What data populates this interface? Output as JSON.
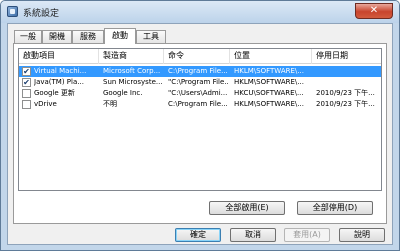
{
  "window": {
    "title": "系統設定",
    "close_label": "✕"
  },
  "tabs": [
    {
      "label": "一般",
      "active": false
    },
    {
      "label": "開機",
      "active": false
    },
    {
      "label": "服務",
      "active": false
    },
    {
      "label": "啟動",
      "active": true
    },
    {
      "label": "工具",
      "active": false
    }
  ],
  "startup_list": {
    "columns": [
      "啟動項目",
      "製造商",
      "命令",
      "位置",
      "停用日期"
    ],
    "rows": [
      {
        "checked": true,
        "selected": true,
        "cells": [
          "Virtual Machi...",
          "Microsoft Corp...",
          "C:\\Program File...",
          "HKLM\\SOFTWARE\\...",
          ""
        ]
      },
      {
        "checked": true,
        "selected": false,
        "cells": [
          "Java(TM) Pla...",
          "Sun Microsyste...",
          "\"C:\\Program File...",
          "HKLM\\SOFTWARE\\...",
          ""
        ]
      },
      {
        "checked": false,
        "selected": false,
        "cells": [
          "Google 更新",
          "Google Inc.",
          "\"C:\\Users\\Admi...",
          "HKCU\\SOFTWARE\\...",
          "2010/9/23 下午..."
        ]
      },
      {
        "checked": false,
        "selected": false,
        "cells": [
          "vDrive",
          "不明",
          "C:\\Program File...",
          "HKLM\\SOFTWARE\\...",
          "2010/9/23 下午..."
        ]
      }
    ]
  },
  "panel_buttons": {
    "enable_all": "全部啟用(E)",
    "disable_all": "全部停用(D)"
  },
  "dialog_buttons": {
    "ok": "確定",
    "cancel": "取消",
    "apply": "套用(A)",
    "help": "說明"
  },
  "icons": {
    "app": "settings-app-icon",
    "check": "✔"
  }
}
